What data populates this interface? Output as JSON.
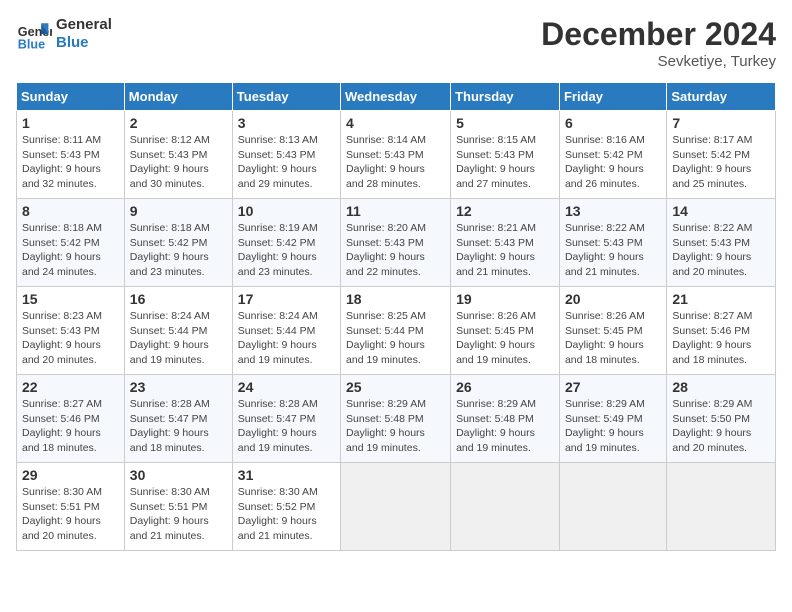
{
  "header": {
    "logo_text_general": "General",
    "logo_text_blue": "Blue",
    "month": "December 2024",
    "location": "Sevketiye, Turkey"
  },
  "days_of_week": [
    "Sunday",
    "Monday",
    "Tuesday",
    "Wednesday",
    "Thursday",
    "Friday",
    "Saturday"
  ],
  "weeks": [
    [
      {
        "day": "1",
        "info": "Sunrise: 8:11 AM\nSunset: 5:43 PM\nDaylight: 9 hours\nand 32 minutes."
      },
      {
        "day": "2",
        "info": "Sunrise: 8:12 AM\nSunset: 5:43 PM\nDaylight: 9 hours\nand 30 minutes."
      },
      {
        "day": "3",
        "info": "Sunrise: 8:13 AM\nSunset: 5:43 PM\nDaylight: 9 hours\nand 29 minutes."
      },
      {
        "day": "4",
        "info": "Sunrise: 8:14 AM\nSunset: 5:43 PM\nDaylight: 9 hours\nand 28 minutes."
      },
      {
        "day": "5",
        "info": "Sunrise: 8:15 AM\nSunset: 5:43 PM\nDaylight: 9 hours\nand 27 minutes."
      },
      {
        "day": "6",
        "info": "Sunrise: 8:16 AM\nSunset: 5:42 PM\nDaylight: 9 hours\nand 26 minutes."
      },
      {
        "day": "7",
        "info": "Sunrise: 8:17 AM\nSunset: 5:42 PM\nDaylight: 9 hours\nand 25 minutes."
      }
    ],
    [
      {
        "day": "8",
        "info": "Sunrise: 8:18 AM\nSunset: 5:42 PM\nDaylight: 9 hours\nand 24 minutes."
      },
      {
        "day": "9",
        "info": "Sunrise: 8:18 AM\nSunset: 5:42 PM\nDaylight: 9 hours\nand 23 minutes."
      },
      {
        "day": "10",
        "info": "Sunrise: 8:19 AM\nSunset: 5:42 PM\nDaylight: 9 hours\nand 23 minutes."
      },
      {
        "day": "11",
        "info": "Sunrise: 8:20 AM\nSunset: 5:43 PM\nDaylight: 9 hours\nand 22 minutes."
      },
      {
        "day": "12",
        "info": "Sunrise: 8:21 AM\nSunset: 5:43 PM\nDaylight: 9 hours\nand 21 minutes."
      },
      {
        "day": "13",
        "info": "Sunrise: 8:22 AM\nSunset: 5:43 PM\nDaylight: 9 hours\nand 21 minutes."
      },
      {
        "day": "14",
        "info": "Sunrise: 8:22 AM\nSunset: 5:43 PM\nDaylight: 9 hours\nand 20 minutes."
      }
    ],
    [
      {
        "day": "15",
        "info": "Sunrise: 8:23 AM\nSunset: 5:43 PM\nDaylight: 9 hours\nand 20 minutes."
      },
      {
        "day": "16",
        "info": "Sunrise: 8:24 AM\nSunset: 5:44 PM\nDaylight: 9 hours\nand 19 minutes."
      },
      {
        "day": "17",
        "info": "Sunrise: 8:24 AM\nSunset: 5:44 PM\nDaylight: 9 hours\nand 19 minutes."
      },
      {
        "day": "18",
        "info": "Sunrise: 8:25 AM\nSunset: 5:44 PM\nDaylight: 9 hours\nand 19 minutes."
      },
      {
        "day": "19",
        "info": "Sunrise: 8:26 AM\nSunset: 5:45 PM\nDaylight: 9 hours\nand 19 minutes."
      },
      {
        "day": "20",
        "info": "Sunrise: 8:26 AM\nSunset: 5:45 PM\nDaylight: 9 hours\nand 18 minutes."
      },
      {
        "day": "21",
        "info": "Sunrise: 8:27 AM\nSunset: 5:46 PM\nDaylight: 9 hours\nand 18 minutes."
      }
    ],
    [
      {
        "day": "22",
        "info": "Sunrise: 8:27 AM\nSunset: 5:46 PM\nDaylight: 9 hours\nand 18 minutes."
      },
      {
        "day": "23",
        "info": "Sunrise: 8:28 AM\nSunset: 5:47 PM\nDaylight: 9 hours\nand 18 minutes."
      },
      {
        "day": "24",
        "info": "Sunrise: 8:28 AM\nSunset: 5:47 PM\nDaylight: 9 hours\nand 19 minutes."
      },
      {
        "day": "25",
        "info": "Sunrise: 8:29 AM\nSunset: 5:48 PM\nDaylight: 9 hours\nand 19 minutes."
      },
      {
        "day": "26",
        "info": "Sunrise: 8:29 AM\nSunset: 5:48 PM\nDaylight: 9 hours\nand 19 minutes."
      },
      {
        "day": "27",
        "info": "Sunrise: 8:29 AM\nSunset: 5:49 PM\nDaylight: 9 hours\nand 19 minutes."
      },
      {
        "day": "28",
        "info": "Sunrise: 8:29 AM\nSunset: 5:50 PM\nDaylight: 9 hours\nand 20 minutes."
      }
    ],
    [
      {
        "day": "29",
        "info": "Sunrise: 8:30 AM\nSunset: 5:51 PM\nDaylight: 9 hours\nand 20 minutes."
      },
      {
        "day": "30",
        "info": "Sunrise: 8:30 AM\nSunset: 5:51 PM\nDaylight: 9 hours\nand 21 minutes."
      },
      {
        "day": "31",
        "info": "Sunrise: 8:30 AM\nSunset: 5:52 PM\nDaylight: 9 hours\nand 21 minutes."
      },
      null,
      null,
      null,
      null
    ]
  ]
}
